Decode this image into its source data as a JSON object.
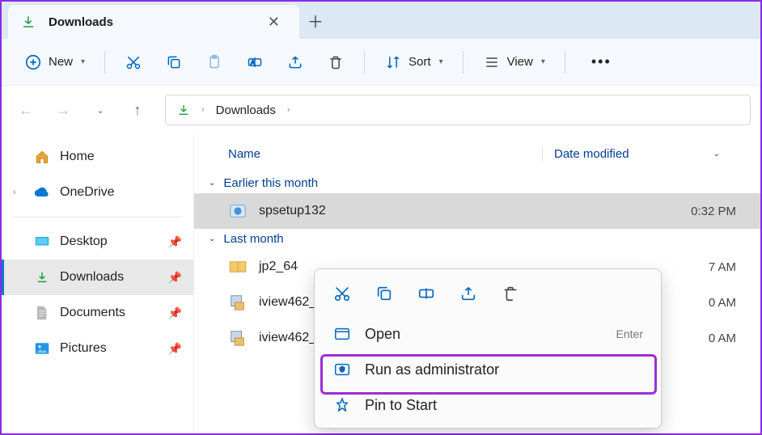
{
  "tab": {
    "title": "Downloads"
  },
  "toolbar": {
    "new": "New",
    "sort": "Sort",
    "view": "View"
  },
  "breadcrumb": {
    "current": "Downloads"
  },
  "sidebar": {
    "home": "Home",
    "onedrive": "OneDrive",
    "desktop": "Desktop",
    "downloads": "Downloads",
    "documents": "Documents",
    "pictures": "Pictures"
  },
  "columns": {
    "name": "Name",
    "date": "Date modified"
  },
  "groups": {
    "g1": {
      "label": "Earlier this month"
    },
    "g2": {
      "label": "Last month"
    }
  },
  "files": {
    "f1": {
      "name": "spsetup132",
      "date_suffix": "0:32 PM"
    },
    "f2": {
      "name": "jp2_64",
      "date_suffix": "7 AM"
    },
    "f3": {
      "name": "iview462_",
      "date_suffix": "0 AM"
    },
    "f4": {
      "name": "iview462_x",
      "date_suffix": "0 AM"
    }
  },
  "context": {
    "open": "Open",
    "open_shortcut": "Enter",
    "run_admin": "Run as administrator",
    "pin_start": "Pin to Start"
  }
}
